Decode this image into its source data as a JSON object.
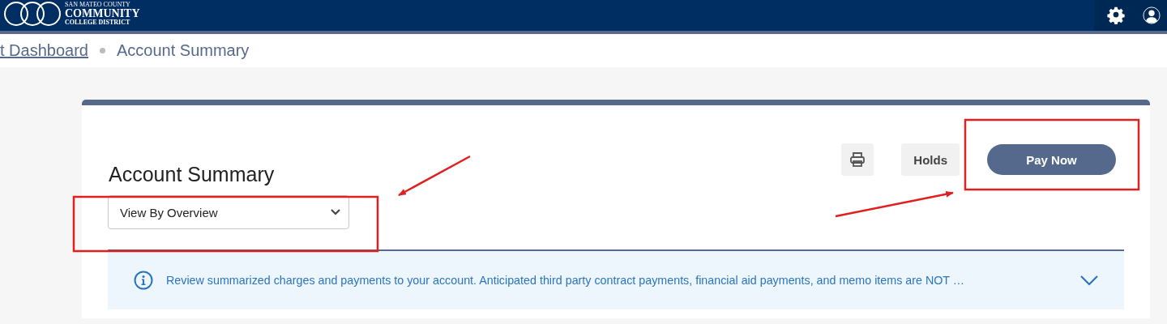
{
  "header": {
    "logo": {
      "line_1": "SAN MATEO COUNTY",
      "line_2": "COMMUNITY",
      "line_3": "COLLEGE DISTRICT"
    }
  },
  "breadcrumb": [
    {
      "label": "t Dashboard",
      "kind": "link"
    },
    {
      "label": "Account Summary",
      "kind": "current"
    }
  ],
  "card": {
    "title": "Account Summary",
    "view_select": {
      "value": "View By Overview"
    },
    "buttons": [
      {
        "kind": "print"
      },
      {
        "kind": "secondary",
        "label": "Holds"
      },
      {
        "kind": "primary",
        "label": "Pay Now"
      }
    ],
    "notice": {
      "text": "Review summarized charges and payments to your account. Anticipated third party contract payments, financial aid payments, and memo items are NOT …",
      "expanded": false
    }
  }
}
